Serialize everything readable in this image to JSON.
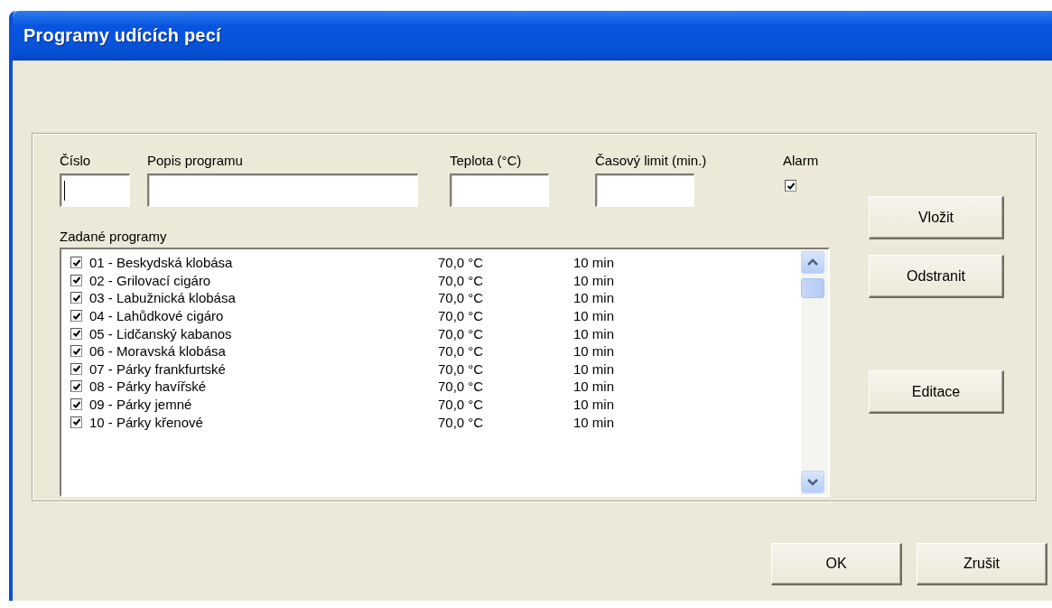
{
  "window": {
    "title": "Programy udících pecí"
  },
  "fields": [
    {
      "label": "Číslo",
      "focused": true
    },
    {
      "label": "Popis programu",
      "focused": false
    },
    {
      "label": "Teplota (°C)",
      "focused": false
    },
    {
      "label": "Časový limit (min.)",
      "focused": false
    }
  ],
  "alarm": {
    "label": "Alarm",
    "checked": true
  },
  "list": {
    "label": "Zadané programy",
    "rows": [
      {
        "checked": true,
        "name": "01 - Beskydská klobása",
        "temperature": "70,0 °C",
        "time": "10 min"
      },
      {
        "checked": true,
        "name": "02 - Grilovací cigáro",
        "temperature": "70,0 °C",
        "time": "10 min"
      },
      {
        "checked": true,
        "name": "03 - Labužnická klobása",
        "temperature": "70,0 °C",
        "time": "10 min"
      },
      {
        "checked": true,
        "name": "04 - Lahůdkové cigáro",
        "temperature": "70,0 °C",
        "time": "10 min"
      },
      {
        "checked": true,
        "name": "05 - Lidčanský kabanos",
        "temperature": "70,0 °C",
        "time": "10 min"
      },
      {
        "checked": true,
        "name": "06 - Moravská klobása",
        "temperature": "70,0 °C",
        "time": "10 min"
      },
      {
        "checked": true,
        "name": "07 - Párky frankfurtské",
        "temperature": "70,0 °C",
        "time": "10 min"
      },
      {
        "checked": true,
        "name": "08 - Párky havířské",
        "temperature": "70,0 °C",
        "time": "10 min"
      },
      {
        "checked": true,
        "name": "09 - Párky jemné",
        "temperature": "70,0 °C",
        "time": "10 min"
      },
      {
        "checked": true,
        "name": "10 - Párky křenové",
        "temperature": "70,0 °C",
        "time": "10 min"
      }
    ]
  },
  "side_buttons": [
    "Vložit",
    "Odstranit",
    "Editace"
  ],
  "bottom_buttons": [
    "OK",
    "Zrušit"
  ]
}
